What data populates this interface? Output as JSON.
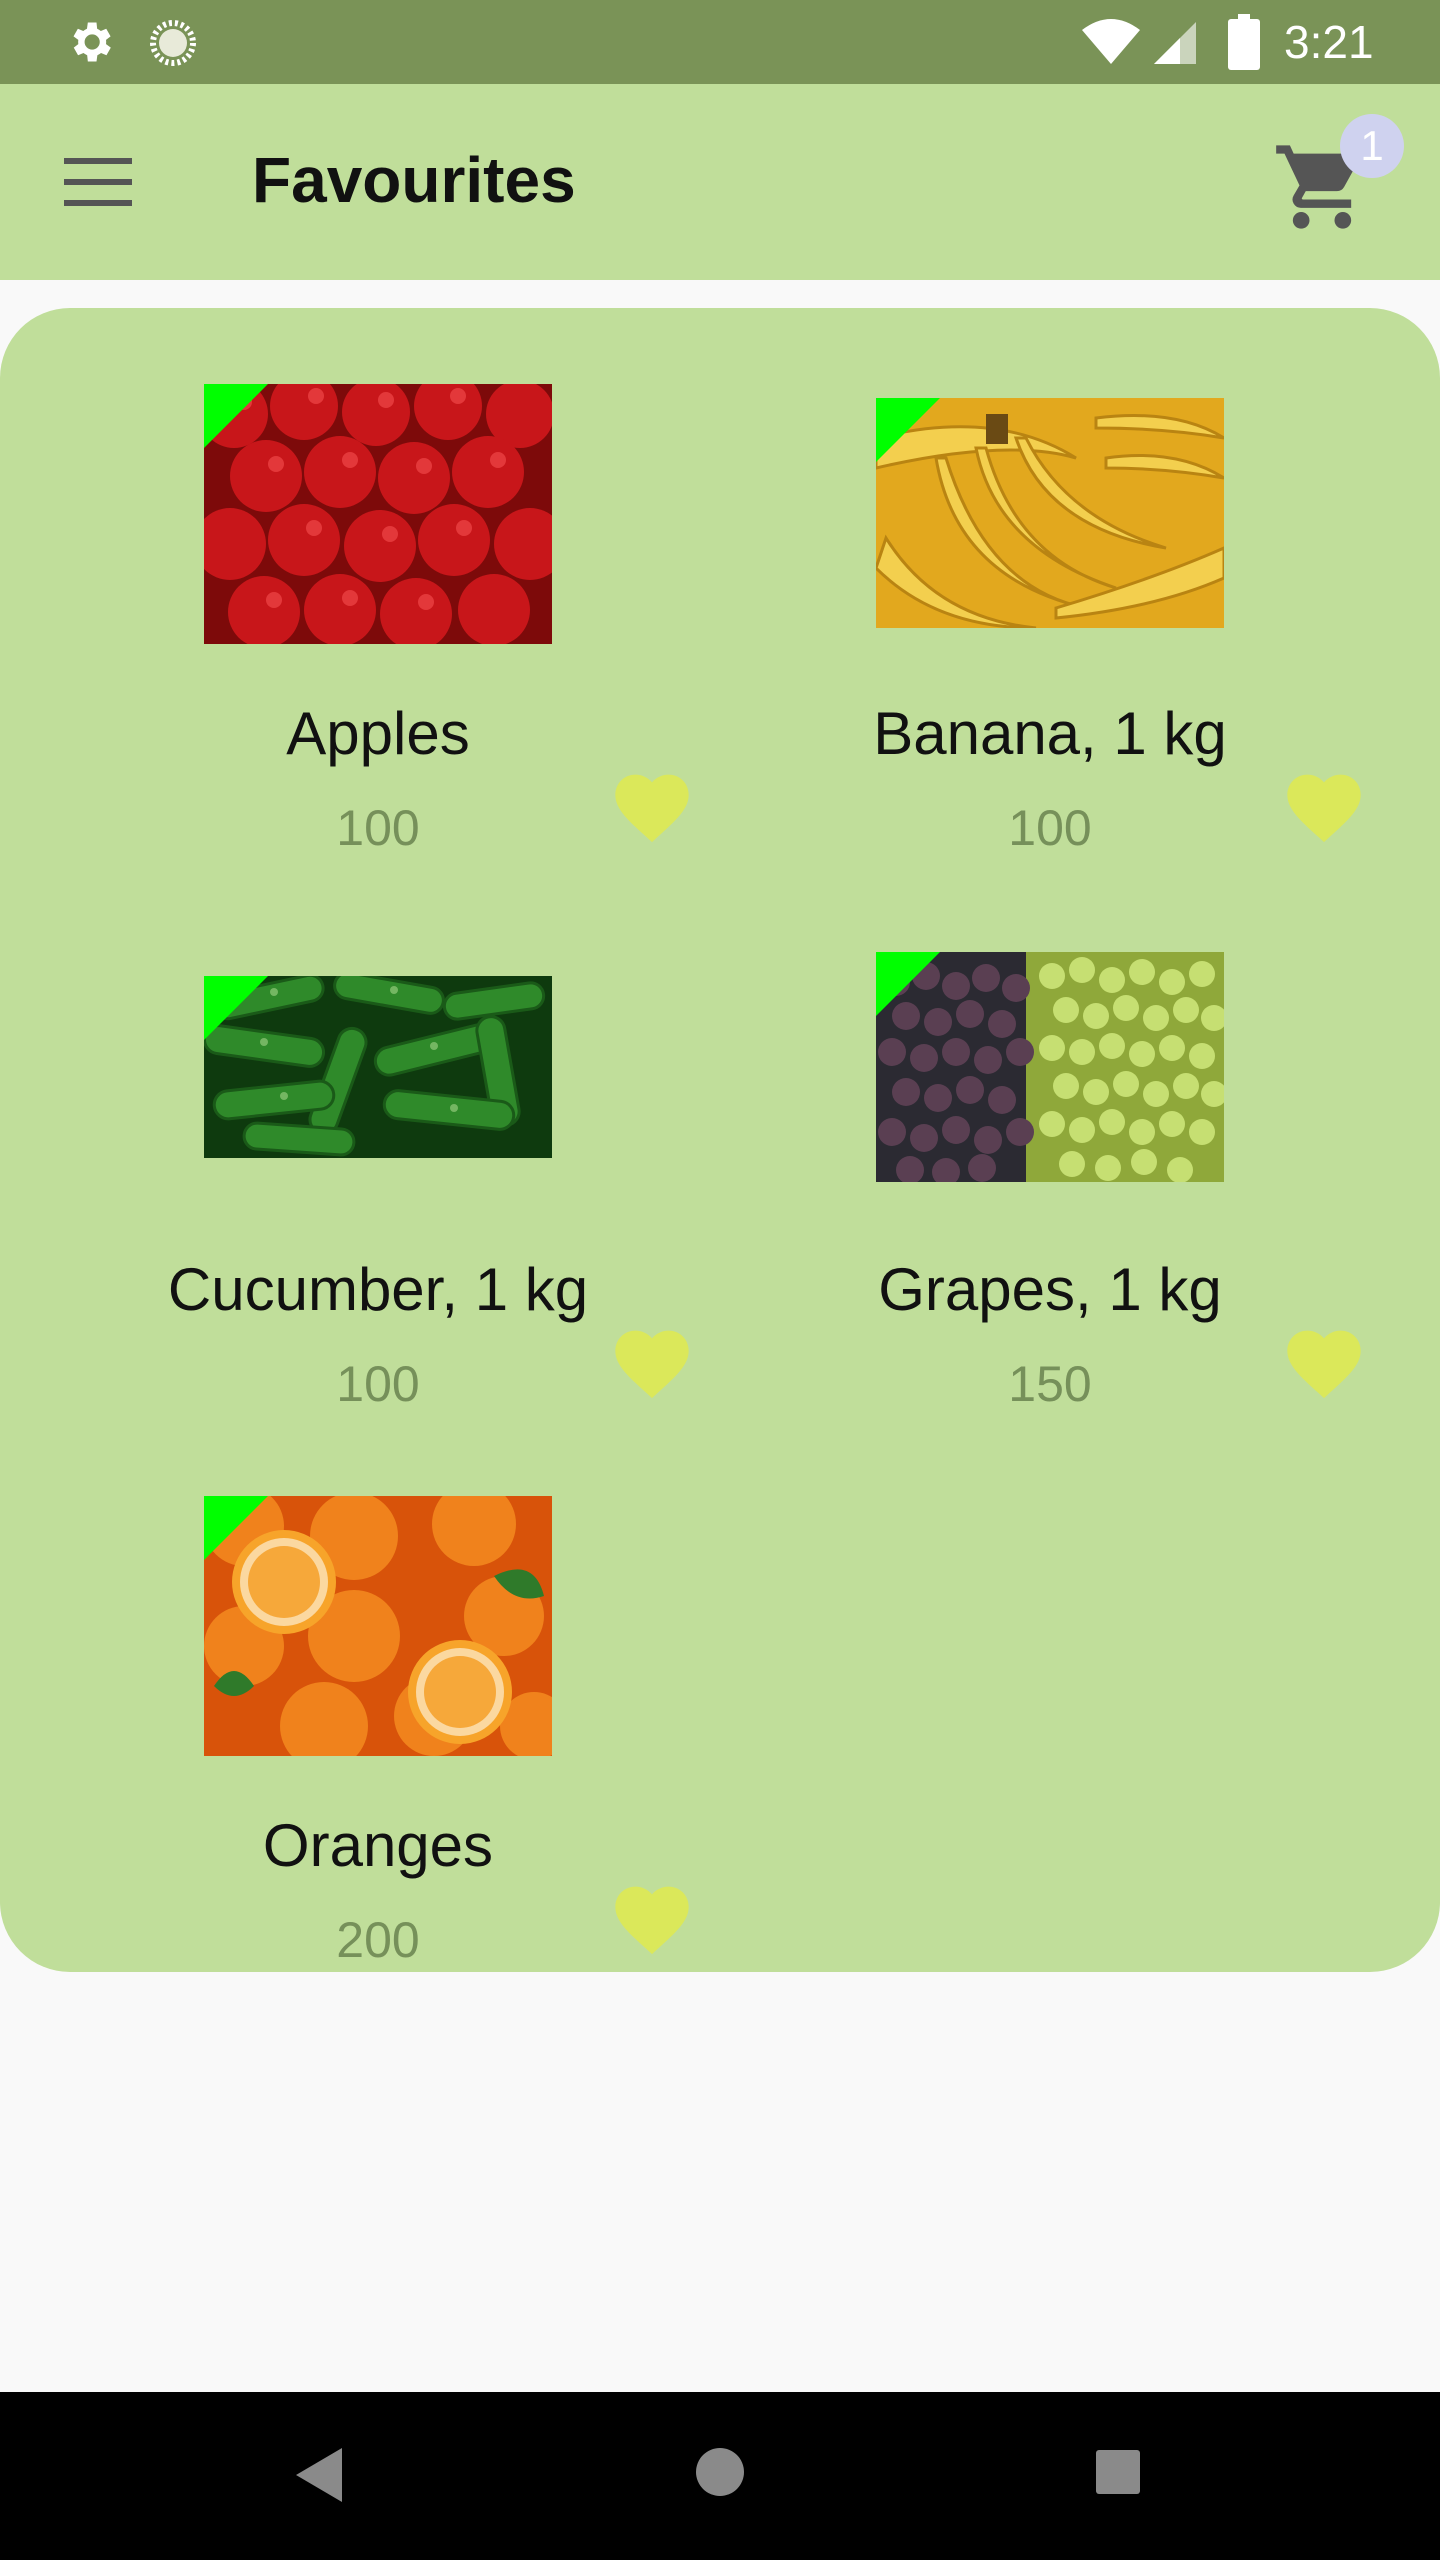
{
  "status_bar": {
    "time": "3:21",
    "icons": [
      "gear-icon",
      "sync-icon",
      "wifi-icon",
      "signal-icon",
      "battery-icon"
    ]
  },
  "app_bar": {
    "title": "Favourites",
    "cart_badge": "1",
    "menu_icon": "hamburger-menu-icon",
    "cart_icon": "shopping-cart-icon"
  },
  "products": [
    {
      "name": "Apples",
      "price": "100",
      "favorite": true
    },
    {
      "name": "Banana, 1 kg",
      "price": "100",
      "favorite": true
    },
    {
      "name": "Cucumber, 1 kg",
      "price": "100",
      "favorite": true
    },
    {
      "name": "Grapes, 1 kg",
      "price": "150",
      "favorite": true
    },
    {
      "name": "Oranges",
      "price": "200",
      "favorite": true
    }
  ],
  "colors": {
    "status_bar": "#7a9357",
    "app_bar": "#c0de9a",
    "card": "#c0de9a",
    "heart": "#dbe85a",
    "price": "#76905a",
    "badge": "#cfd2ef",
    "corner_tag": "#00ff00"
  },
  "nav_bar": {
    "icons": [
      "back-icon",
      "home-icon",
      "recents-icon"
    ]
  }
}
